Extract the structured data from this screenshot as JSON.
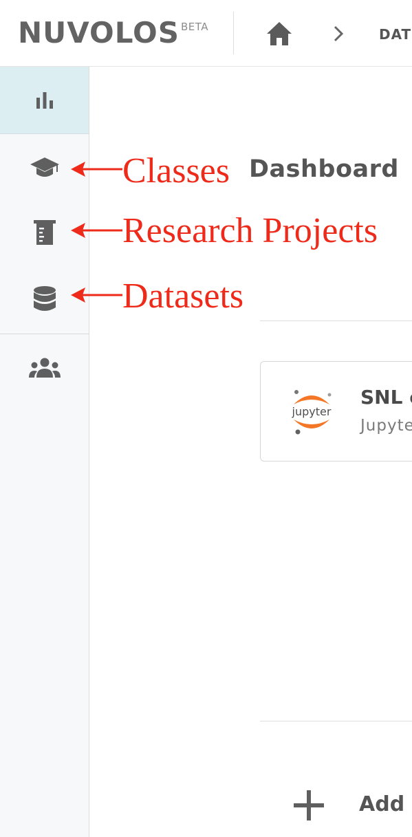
{
  "header": {
    "logo": "NUVOLOS",
    "logo_badge": "BETA",
    "breadcrumb": "DAT"
  },
  "sidebar": {
    "items": [
      {
        "icon": "bar-chart-icon",
        "active": true
      },
      {
        "icon": "graduation-cap-icon"
      },
      {
        "icon": "beaker-icon"
      },
      {
        "icon": "database-icon"
      },
      {
        "icon": "users-icon"
      }
    ]
  },
  "annotations": {
    "classes": "Classes",
    "research_projects": "Research Projects",
    "datasets": "Datasets",
    "color": "#ee2a1a"
  },
  "main": {
    "title": "Dashboard",
    "card": {
      "logo_text": "jupyter",
      "title": "SNL c",
      "subtitle": "Jupyte"
    },
    "add_label": "Add a"
  },
  "colors": {
    "sidebar_bg": "#f6f8fa",
    "sidebar_active_bg": "#ddeef3",
    "icon_gray": "#5f5f5f",
    "jupyter_orange": "#f37726"
  }
}
